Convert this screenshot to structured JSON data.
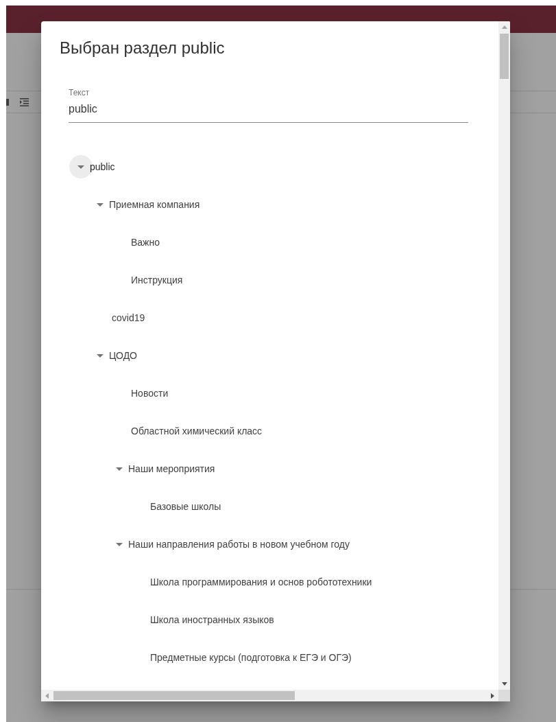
{
  "dialog": {
    "title": "Выбран раздел public",
    "field": {
      "label": "Текст",
      "value": "public"
    },
    "tree": [
      {
        "label": "public",
        "expanded": true,
        "selected": true,
        "children": [
          {
            "label": "Приемная компания",
            "expanded": true,
            "selected": false,
            "children": [
              {
                "label": "Важно",
                "selected": false
              },
              {
                "label": "Инструкция",
                "selected": false
              }
            ]
          },
          {
            "label": "covid19",
            "selected": false
          },
          {
            "label": "ЦОДО",
            "expanded": true,
            "selected": false,
            "children": [
              {
                "label": "Новости",
                "selected": false
              },
              {
                "label": "Областной химический класс",
                "selected": false
              },
              {
                "label": "Наши мероприятия",
                "expanded": true,
                "selected": false,
                "children": [
                  {
                    "label": "Базовые школы",
                    "selected": false
                  }
                ]
              },
              {
                "label": "Наши направления работы в новом учебном году",
                "expanded": true,
                "selected": false,
                "children": [
                  {
                    "label": "Школа программирования и основ робототехники",
                    "selected": false
                  },
                  {
                    "label": "Школа иностранных языков",
                    "selected": false
                  },
                  {
                    "label": "Предметные курсы (подготовка к ЕГЭ и ОГЭ)",
                    "selected": false
                  }
                ]
              }
            ]
          }
        ]
      }
    ]
  }
}
